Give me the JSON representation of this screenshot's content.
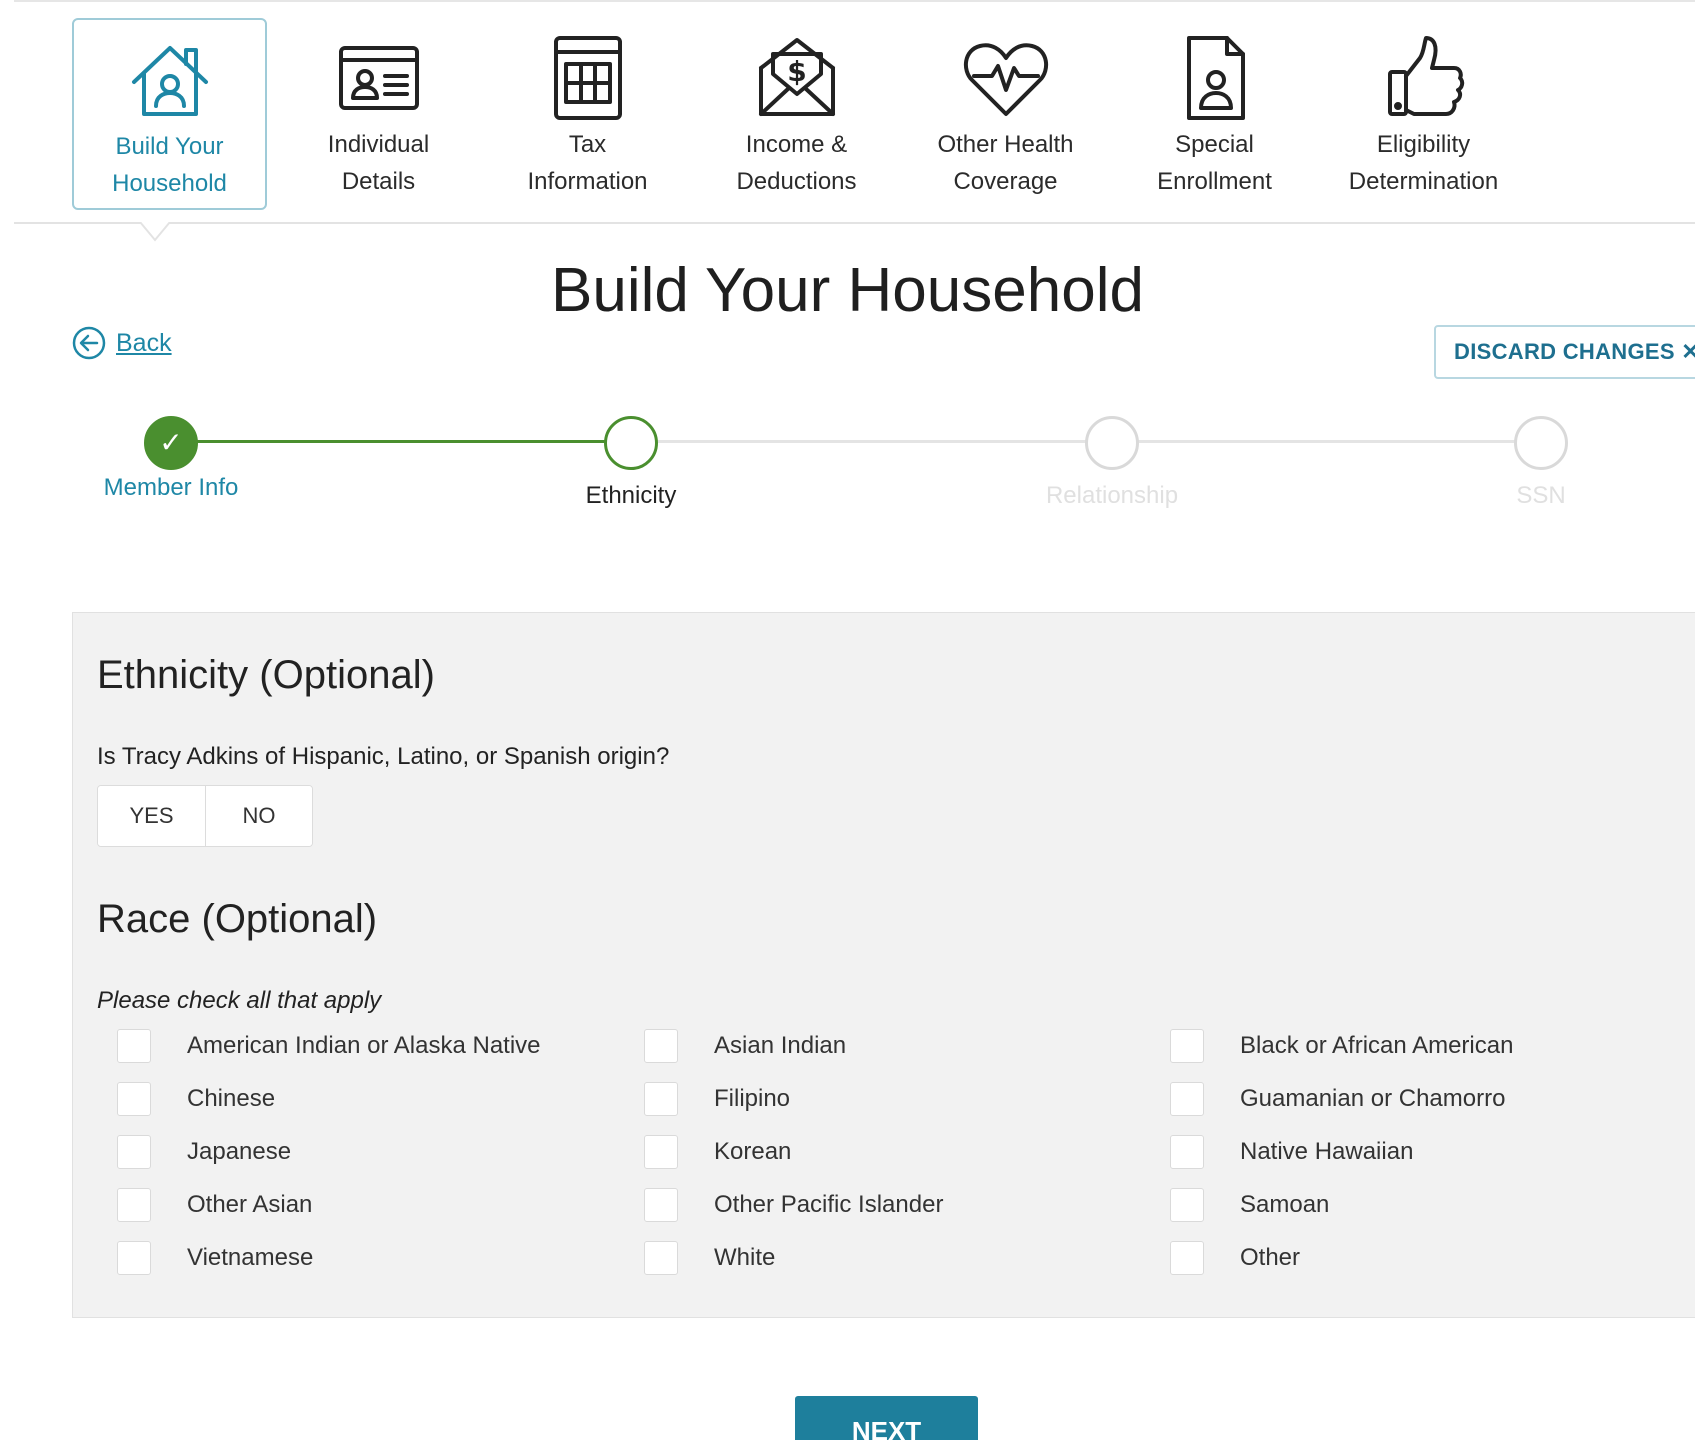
{
  "nav": {
    "items": [
      {
        "line1": "Build Your",
        "line2": "Household",
        "icon": "house-icon"
      },
      {
        "line1": "Individual",
        "line2": "Details",
        "icon": "id-card-icon"
      },
      {
        "line1": "Tax",
        "line2": "Information",
        "icon": "calculator-icon"
      },
      {
        "line1": "Income &",
        "line2": "Deductions",
        "icon": "money-envelope-icon"
      },
      {
        "line1": "Other Health",
        "line2": "Coverage",
        "icon": "heartbeat-icon"
      },
      {
        "line1": "Special",
        "line2": "Enrollment",
        "icon": "person-document-icon"
      },
      {
        "line1": "Eligibility",
        "line2": "Determination",
        "icon": "thumbs-up-icon"
      }
    ],
    "active_index": 0
  },
  "page": {
    "title": "Build Your Household",
    "back_label": "Back",
    "discard_label": "DISCARD CHANGES ✕"
  },
  "stepper": {
    "steps": [
      {
        "label": "Member Info",
        "state": "done",
        "mark": "✓"
      },
      {
        "label": "Ethnicity",
        "state": "current"
      },
      {
        "label": "Relationship",
        "state": "todo"
      },
      {
        "label": "SSN",
        "state": "todo"
      }
    ]
  },
  "form": {
    "ethnicity_heading": "Ethnicity (Optional)",
    "ethnicity_question": "Is Tracy Adkins of Hispanic, Latino, or Spanish origin?",
    "yes_label": "YES",
    "no_label": "NO",
    "race_heading": "Race (Optional)",
    "race_hint": "Please check all that apply",
    "race_options": [
      [
        "American Indian or Alaska Native",
        "Asian Indian",
        "Black or African American"
      ],
      [
        "Chinese",
        "Filipino",
        "Guamanian or Chamorro"
      ],
      [
        "Japanese",
        "Korean",
        "Native Hawaiian"
      ],
      [
        "Other Asian",
        "Other Pacific Islander",
        "Samoan"
      ],
      [
        "Vietnamese",
        "White",
        "Other"
      ]
    ]
  },
  "footer": {
    "next_label": "NEXT"
  },
  "colors": {
    "accent": "#1e87a6",
    "success": "#4a8f2f",
    "panel_bg": "#f2f2f2",
    "next_bg": "#1e7f9c"
  }
}
